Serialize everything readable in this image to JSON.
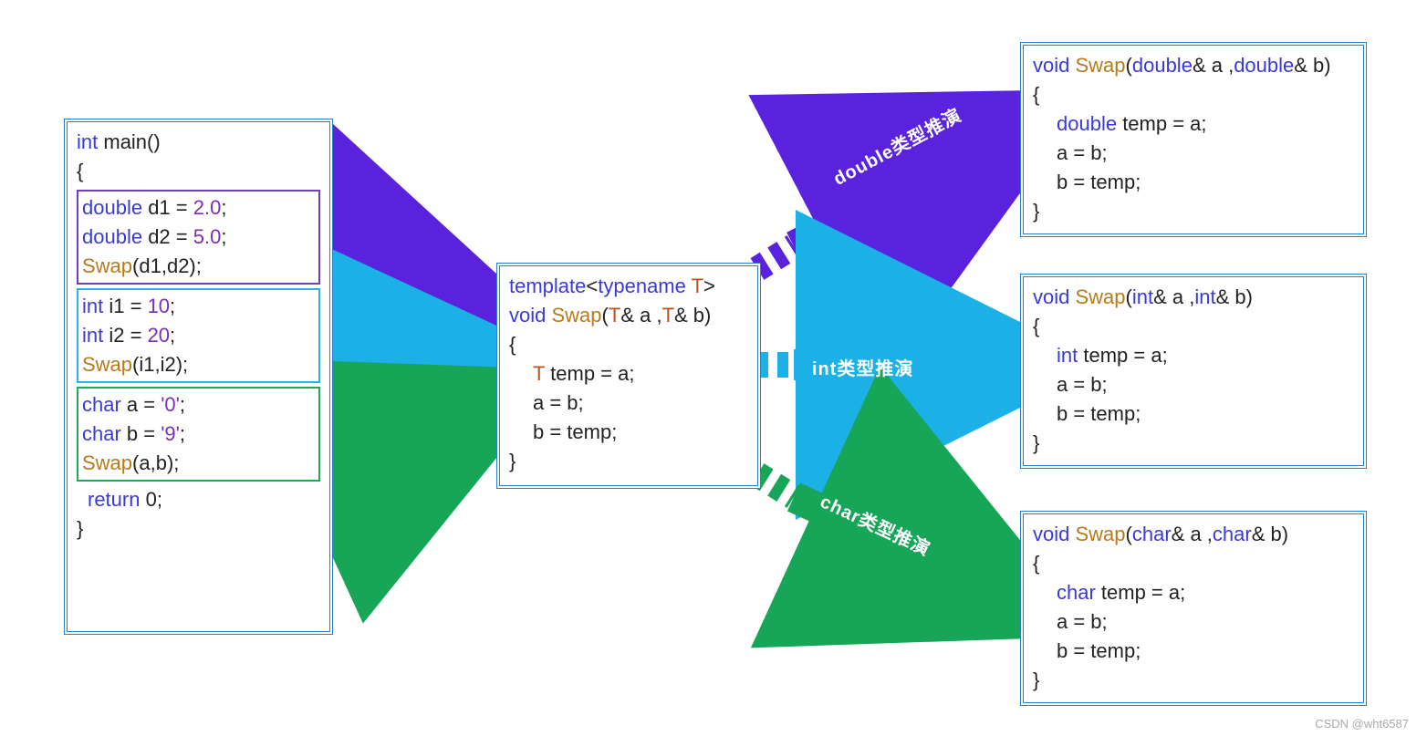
{
  "diagram": {
    "colors": {
      "outer": "#2a7fcc",
      "purpleBox": "#6a3fc2",
      "cyanBox": "#2bb4e6",
      "greenBox": "#22aa55",
      "arrowPurple": "#5a22dd",
      "arrowCyan": "#1bb0e6",
      "arrowGreen": "#17a557"
    },
    "main": {
      "sig_kw": "int",
      "sig_rest": " main()",
      "open": "{",
      "ret_kw": "return",
      "ret_rest": " 0;",
      "close": "}",
      "blocks": {
        "d": {
          "l1_kw": "double",
          "l1_rest": " d1 = ",
          "l1_num": "2.0",
          "l1_semi": ";",
          "l2_kw": "double",
          "l2_rest": " d2 = ",
          "l2_num": "5.0",
          "l2_semi": ";",
          "call_fn": "Swap",
          "call_args": "(d1,d2);"
        },
        "i": {
          "l1_kw": "int",
          "l1_rest": " i1 = ",
          "l1_num": "10",
          "l1_semi": ";",
          "l2_kw": "int",
          "l2_rest": " i2 = ",
          "l2_num": "20",
          "l2_semi": ";",
          "call_fn": "Swap",
          "call_args": "(i1,i2);"
        },
        "c": {
          "l1_kw": "char",
          "l1_rest": " a = ",
          "l1_num": "'0'",
          "l1_semi": ";",
          "l2_kw": "char",
          "l2_rest": " b = ",
          "l2_num": "'9'",
          "l2_semi": ";",
          "call_fn": "Swap",
          "call_args": "(a,b);"
        }
      }
    },
    "template": {
      "l1_a": "template",
      "l1_b": "<",
      "l1_c": "typename",
      "l1_d": " T",
      "l1_e": ">",
      "l2_a": "void",
      "l2_b": " ",
      "l2_c": "Swap",
      "l2_d": "(",
      "l2_e": "T",
      "l2_f": "& a ,",
      "l2_g": "T",
      "l2_h": "& b)",
      "open": "{",
      "body1_a": "T",
      "body1_b": " temp = a;",
      "body2": "a = b;",
      "body3": "b = temp;",
      "close": "}"
    },
    "outputs": {
      "double": {
        "sig_a": "void",
        "sig_b": " ",
        "sig_c": "Swap",
        "sig_d": "(",
        "sig_e": "double",
        "sig_f": "& a ,",
        "sig_g": "double",
        "sig_h": "& b)",
        "open": "{",
        "b1_a": "double",
        "b1_b": " temp = a;",
        "b2": "a = b;",
        "b3": "b = temp;",
        "close": "}"
      },
      "int": {
        "sig_a": "void",
        "sig_b": " ",
        "sig_c": "Swap",
        "sig_d": "(",
        "sig_e": "int",
        "sig_f": "& a ,",
        "sig_g": "int",
        "sig_h": "& b)",
        "open": "{",
        "b1_a": "int",
        "b1_b": " temp = a;",
        "b2": "a = b;",
        "b3": "b = temp;",
        "close": "}"
      },
      "char": {
        "sig_a": "void",
        "sig_b": " ",
        "sig_c": "Swap",
        "sig_d": "(",
        "sig_e": "char",
        "sig_f": "& a ,",
        "sig_g": "char",
        "sig_h": "& b)",
        "open": "{",
        "b1_a": "char",
        "b1_b": " temp = a;",
        "b2": "a = b;",
        "b3": "b = temp;",
        "close": "}"
      }
    },
    "arrow_labels": {
      "double": "double类型推演",
      "int": "int类型推演",
      "char": "char类型推演"
    },
    "watermark": "CSDN @wht6587"
  }
}
